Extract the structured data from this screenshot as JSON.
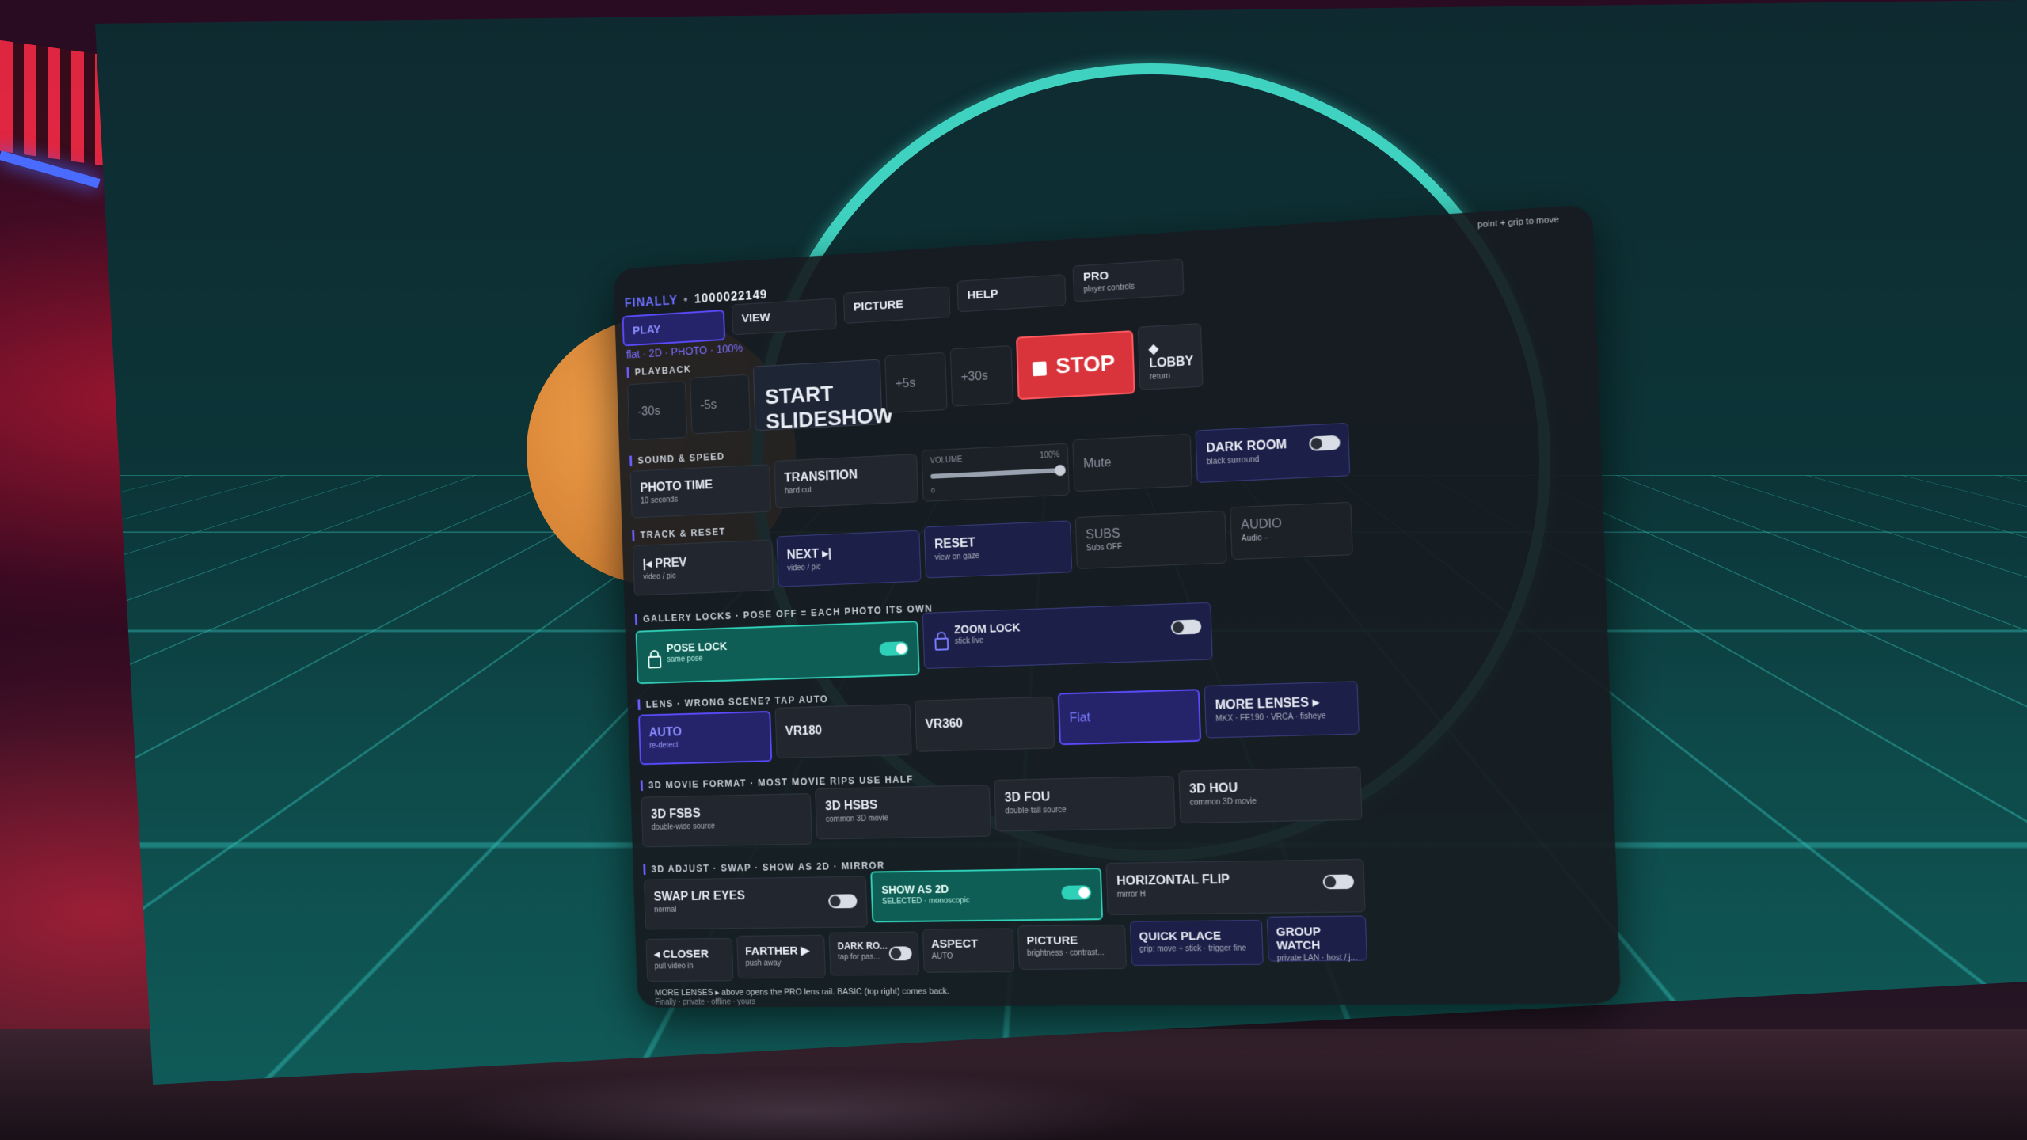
{
  "header": {
    "app_name": "FINALLY",
    "separator": "•",
    "item_id": "1000022149",
    "grip_hint": "point + grip to move"
  },
  "tabs": [
    {
      "label": "PLAY",
      "active": true
    },
    {
      "label": "VIEW"
    },
    {
      "label": "PICTURE"
    },
    {
      "label": "HELP"
    },
    {
      "label": "PRO",
      "sub": "player controls"
    }
  ],
  "mode_line": "flat · 2D · PHOTO · 100%",
  "playback": {
    "title": "PLAYBACK",
    "back30": "-30s",
    "back5": "-5s",
    "start": "START SLIDESHOW",
    "fwd5": "+5s",
    "fwd30": "+30s",
    "stop": "STOP",
    "lobby": "LOBBY",
    "lobby_sub": "return",
    "lobby_icon": "diamond-icon"
  },
  "sound": {
    "title": "SOUND & SPEED",
    "photo_time": "PHOTO TIME",
    "photo_time_sub": "10 seconds",
    "transition": "TRANSITION",
    "transition_sub": "hard cut",
    "volume_label": "VOLUME",
    "volume_value": "100%",
    "volume_level": 1.0,
    "volume_min": "0",
    "mute": "Mute",
    "dark_room": "DARK ROOM",
    "dark_room_sub": "black surround"
  },
  "track": {
    "title": "TRACK & RESET",
    "prev": "PREV",
    "prev_sub": "video / pic",
    "next": "NEXT",
    "next_sub": "video / pic",
    "reset": "RESET",
    "reset_sub": "view on gaze",
    "subs": "SUBS",
    "subs_sub": "Subs OFF",
    "audio": "AUDIO",
    "audio_sub": "Audio –"
  },
  "gallery": {
    "title": "GALLERY LOCKS",
    "note": "POSE OFF = EACH PHOTO ITS OWN",
    "pose_lock": "POSE LOCK",
    "pose_lock_sub": "same pose",
    "zoom_lock": "ZOOM LOCK",
    "zoom_lock_sub": "stick live"
  },
  "lens": {
    "title": "LENS",
    "note": "WRONG SCENE?  TAP AUTO",
    "auto": "AUTO",
    "auto_sub": "re-detect",
    "vr180": "VR180",
    "vr360": "VR360",
    "flat": "Flat",
    "more": "MORE LENSES ▸",
    "more_sub": "MKX · FE190 · VRCA · fisheye"
  },
  "movie": {
    "title": "3D MOVIE FORMAT",
    "note": "MOST MOVIE RIPS USE HALF",
    "fsbs": "3D FSBS",
    "fsbs_sub": "double-wide source",
    "hsbs": "3D HSBS",
    "hsbs_sub": "common 3D movie",
    "fou": "3D FOU",
    "fou_sub": "double-tall source",
    "hou": "3D HOU",
    "hou_sub": "common 3D movie"
  },
  "adjust": {
    "title": "3D ADJUST",
    "note": "SWAP · SHOW AS 2D · MIRROR",
    "swap": "SWAP L/R EYES",
    "swap_sub": "normal",
    "show2d": "SHOW AS 2D",
    "show2d_sub": "SELECTED · monoscopic",
    "hflip": "HORIZONTAL FLIP",
    "hflip_sub": "mirror H"
  },
  "bottom": {
    "closer": "CLOSER",
    "closer_sub": "pull video in",
    "farther": "FARTHER ▶",
    "farther_sub": "push away",
    "darkro": "DARK RO...",
    "darkro_sub": "tap for pas...",
    "aspect": "ASPECT",
    "aspect_sub": "AUTO",
    "picture": "PICTURE",
    "picture_sub": "brightness · contrast...",
    "quick": "QUICK PLACE",
    "quick_sub": "grip: move + stick · trigger fine",
    "group": "GROUP WATCH",
    "group_sub": "private LAN · host / j..."
  },
  "footer": {
    "line1": "MORE LENSES ▸  above opens the PRO lens rail. BASIC (top right) comes back.",
    "line2": "Finally · private · offline · yours"
  },
  "colors": {
    "accent": "#5a4bff",
    "stop": "#d9343c",
    "toggle_on": "#2fd0b8",
    "panel": "#161a20"
  }
}
